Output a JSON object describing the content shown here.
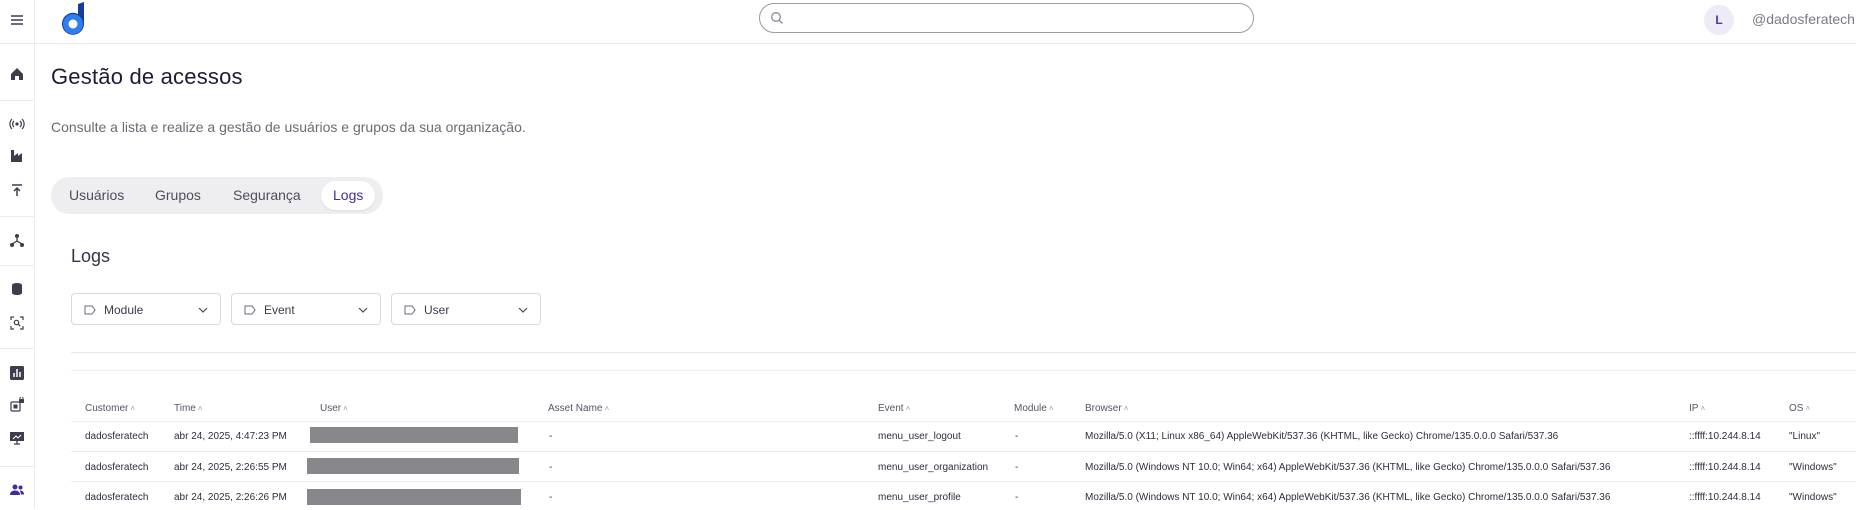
{
  "header": {
    "search": {
      "placeholder": "",
      "value": ""
    },
    "avatar_initial": "L",
    "username": "@dadosferatech"
  },
  "rail": {
    "items": [
      "menu-icon",
      "home-icon",
      "signal-icon",
      "factory-icon",
      "upload-icon",
      "network-icon",
      "database-icon",
      "scan-search-icon",
      "bar-chart-icon",
      "locked-chip-icon",
      "monitor-chart-icon",
      "users-icon"
    ]
  },
  "page": {
    "title": "Gestão de acessos",
    "description": "Consulte a lista e realize a gestão de usuários e grupos da sua organização."
  },
  "tabs": [
    {
      "label": "Usuários",
      "active": false
    },
    {
      "label": "Grupos",
      "active": false
    },
    {
      "label": "Segurança",
      "active": false
    },
    {
      "label": "Logs",
      "active": true
    }
  ],
  "logs": {
    "title": "Logs",
    "filters": [
      {
        "label": "Module"
      },
      {
        "label": "Event"
      },
      {
        "label": "User"
      }
    ],
    "columns": [
      "Customer",
      "Time",
      "User",
      "Asset Name",
      "Event",
      "Module",
      "Browser",
      "IP",
      "OS"
    ],
    "sort_glyph": "˄",
    "rows": [
      {
        "customer": "dadosferatech",
        "time": "abr 24, 2025, 4:47:23 PM",
        "user": "",
        "asset": "-",
        "event": "menu_user_logout",
        "module": "-",
        "browser": "Mozilla/5.0 (X11; Linux x86_64) AppleWebKit/537.36 (KHTML, like Gecko) Chrome/135.0.0.0 Safari/537.36",
        "ip": "::ffff:10.244.8.14",
        "os": "\"Linux\""
      },
      {
        "customer": "dadosferatech",
        "time": "abr 24, 2025, 2:26:55 PM",
        "user": "",
        "asset": "-",
        "event": "menu_user_organization",
        "module": "-",
        "browser": "Mozilla/5.0 (Windows NT 10.0; Win64; x64) AppleWebKit/537.36 (KHTML, like Gecko) Chrome/135.0.0.0 Safari/537.36",
        "ip": "::ffff:10.244.8.14",
        "os": "\"Windows\""
      },
      {
        "customer": "dadosferatech",
        "time": "abr 24, 2025, 2:26:26 PM",
        "user": "",
        "asset": "-",
        "event": "menu_user_profile",
        "module": "-",
        "browser": "Mozilla/5.0 (Windows NT 10.0; Win64; x64) AppleWebKit/537.36 (KHTML, like Gecko) Chrome/135.0.0.0 Safari/537.36",
        "ip": "::ffff:10.244.8.14",
        "os": "\"Windows\""
      }
    ]
  },
  "colors": {
    "accent": "#3b2fa0",
    "logo_dark": "#1a3a9e",
    "logo_light": "#2d7ff0",
    "redaction": "#86868b"
  }
}
